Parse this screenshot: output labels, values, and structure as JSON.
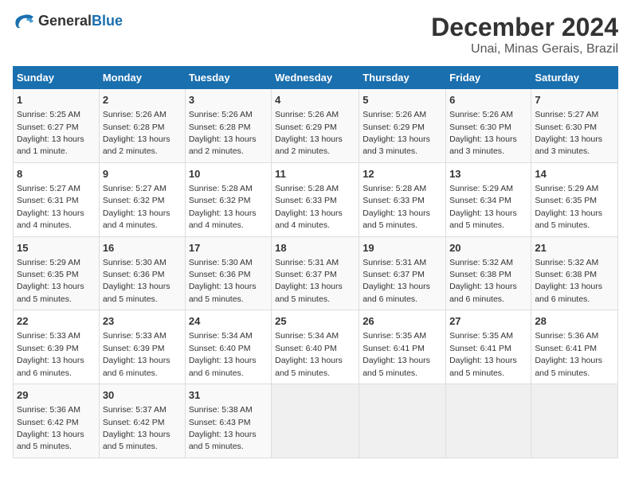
{
  "logo": {
    "general": "General",
    "blue": "Blue"
  },
  "header": {
    "month": "December 2024",
    "location": "Unai, Minas Gerais, Brazil"
  },
  "days_of_week": [
    "Sunday",
    "Monday",
    "Tuesday",
    "Wednesday",
    "Thursday",
    "Friday",
    "Saturday"
  ],
  "weeks": [
    [
      {
        "day": 1,
        "sunrise": "5:25 AM",
        "sunset": "6:27 PM",
        "daylight": "13 hours and 1 minute."
      },
      {
        "day": 2,
        "sunrise": "5:26 AM",
        "sunset": "6:28 PM",
        "daylight": "13 hours and 2 minutes."
      },
      {
        "day": 3,
        "sunrise": "5:26 AM",
        "sunset": "6:28 PM",
        "daylight": "13 hours and 2 minutes."
      },
      {
        "day": 4,
        "sunrise": "5:26 AM",
        "sunset": "6:29 PM",
        "daylight": "13 hours and 2 minutes."
      },
      {
        "day": 5,
        "sunrise": "5:26 AM",
        "sunset": "6:29 PM",
        "daylight": "13 hours and 3 minutes."
      },
      {
        "day": 6,
        "sunrise": "5:26 AM",
        "sunset": "6:30 PM",
        "daylight": "13 hours and 3 minutes."
      },
      {
        "day": 7,
        "sunrise": "5:27 AM",
        "sunset": "6:30 PM",
        "daylight": "13 hours and 3 minutes."
      }
    ],
    [
      {
        "day": 8,
        "sunrise": "5:27 AM",
        "sunset": "6:31 PM",
        "daylight": "13 hours and 4 minutes."
      },
      {
        "day": 9,
        "sunrise": "5:27 AM",
        "sunset": "6:32 PM",
        "daylight": "13 hours and 4 minutes."
      },
      {
        "day": 10,
        "sunrise": "5:28 AM",
        "sunset": "6:32 PM",
        "daylight": "13 hours and 4 minutes."
      },
      {
        "day": 11,
        "sunrise": "5:28 AM",
        "sunset": "6:33 PM",
        "daylight": "13 hours and 4 minutes."
      },
      {
        "day": 12,
        "sunrise": "5:28 AM",
        "sunset": "6:33 PM",
        "daylight": "13 hours and 5 minutes."
      },
      {
        "day": 13,
        "sunrise": "5:29 AM",
        "sunset": "6:34 PM",
        "daylight": "13 hours and 5 minutes."
      },
      {
        "day": 14,
        "sunrise": "5:29 AM",
        "sunset": "6:35 PM",
        "daylight": "13 hours and 5 minutes."
      }
    ],
    [
      {
        "day": 15,
        "sunrise": "5:29 AM",
        "sunset": "6:35 PM",
        "daylight": "13 hours and 5 minutes."
      },
      {
        "day": 16,
        "sunrise": "5:30 AM",
        "sunset": "6:36 PM",
        "daylight": "13 hours and 5 minutes."
      },
      {
        "day": 17,
        "sunrise": "5:30 AM",
        "sunset": "6:36 PM",
        "daylight": "13 hours and 5 minutes."
      },
      {
        "day": 18,
        "sunrise": "5:31 AM",
        "sunset": "6:37 PM",
        "daylight": "13 hours and 5 minutes."
      },
      {
        "day": 19,
        "sunrise": "5:31 AM",
        "sunset": "6:37 PM",
        "daylight": "13 hours and 6 minutes."
      },
      {
        "day": 20,
        "sunrise": "5:32 AM",
        "sunset": "6:38 PM",
        "daylight": "13 hours and 6 minutes."
      },
      {
        "day": 21,
        "sunrise": "5:32 AM",
        "sunset": "6:38 PM",
        "daylight": "13 hours and 6 minutes."
      }
    ],
    [
      {
        "day": 22,
        "sunrise": "5:33 AM",
        "sunset": "6:39 PM",
        "daylight": "13 hours and 6 minutes."
      },
      {
        "day": 23,
        "sunrise": "5:33 AM",
        "sunset": "6:39 PM",
        "daylight": "13 hours and 6 minutes."
      },
      {
        "day": 24,
        "sunrise": "5:34 AM",
        "sunset": "6:40 PM",
        "daylight": "13 hours and 6 minutes."
      },
      {
        "day": 25,
        "sunrise": "5:34 AM",
        "sunset": "6:40 PM",
        "daylight": "13 hours and 5 minutes."
      },
      {
        "day": 26,
        "sunrise": "5:35 AM",
        "sunset": "6:41 PM",
        "daylight": "13 hours and 5 minutes."
      },
      {
        "day": 27,
        "sunrise": "5:35 AM",
        "sunset": "6:41 PM",
        "daylight": "13 hours and 5 minutes."
      },
      {
        "day": 28,
        "sunrise": "5:36 AM",
        "sunset": "6:41 PM",
        "daylight": "13 hours and 5 minutes."
      }
    ],
    [
      {
        "day": 29,
        "sunrise": "5:36 AM",
        "sunset": "6:42 PM",
        "daylight": "13 hours and 5 minutes."
      },
      {
        "day": 30,
        "sunrise": "5:37 AM",
        "sunset": "6:42 PM",
        "daylight": "13 hours and 5 minutes."
      },
      {
        "day": 31,
        "sunrise": "5:38 AM",
        "sunset": "6:43 PM",
        "daylight": "13 hours and 5 minutes."
      },
      null,
      null,
      null,
      null
    ]
  ]
}
